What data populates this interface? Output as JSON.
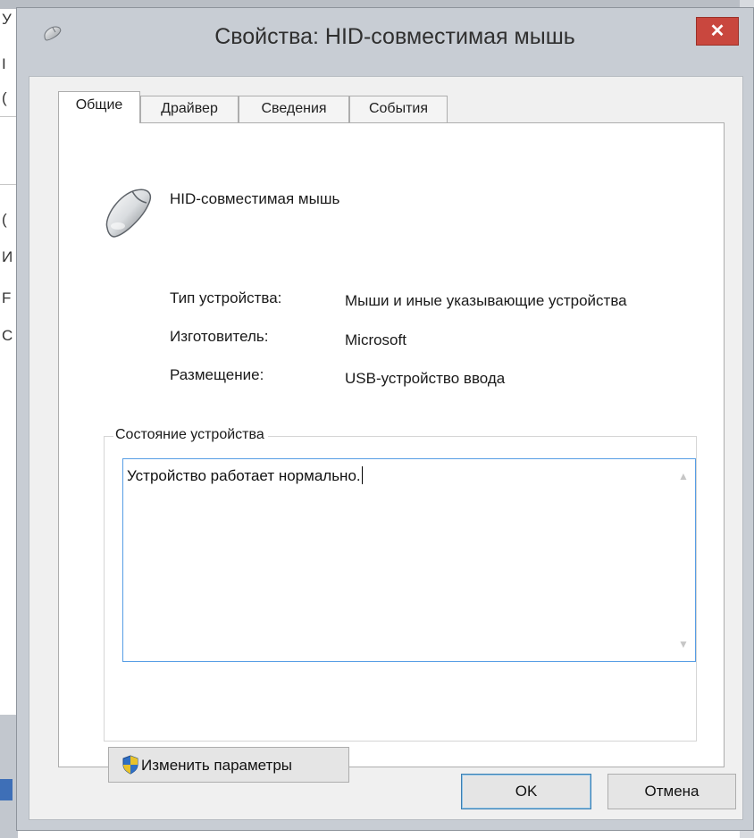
{
  "window": {
    "title": "Свойства: HID-совместимая мышь",
    "close_glyph": "✕"
  },
  "background_letters": [
    "У",
    "I",
    "(",
    "(",
    "И",
    "F",
    "C"
  ],
  "tabs": [
    {
      "label": "Общие",
      "active": true
    },
    {
      "label": "Драйвер",
      "active": false
    },
    {
      "label": "Сведения",
      "active": false
    },
    {
      "label": "События",
      "active": false
    }
  ],
  "device": {
    "name": "HID-совместимая мышь",
    "icon": "mouse-icon"
  },
  "properties": [
    {
      "label": "Тип устройства:",
      "value": "Мыши и иные указывающие устройства"
    },
    {
      "label": "Изготовитель:",
      "value": "Microsoft"
    },
    {
      "label": "Размещение:",
      "value": "USB-устройство ввода"
    }
  ],
  "status": {
    "legend": "Состояние устройства",
    "text": "Устройство работает нормально."
  },
  "change_button": {
    "label": "Изменить параметры",
    "icon": "uac-shield-icon"
  },
  "buttons": {
    "ok": "OK",
    "cancel": "Отмена"
  },
  "colors": {
    "close_button": "#c9473e",
    "focus_border": "#569de5"
  }
}
